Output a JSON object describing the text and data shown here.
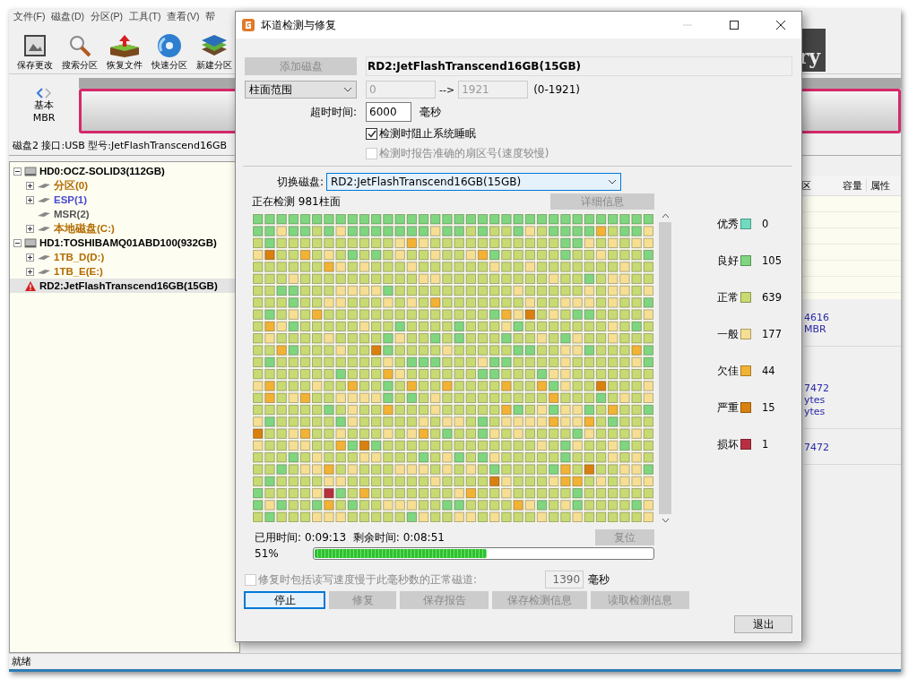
{
  "main_window": {
    "menu": [
      "文件(F)",
      "磁盘(D)",
      "分区(P)",
      "工具(T)",
      "查看(V)",
      "帮"
    ],
    "toolbar": [
      {
        "label": "保存更改",
        "kind": "save"
      },
      {
        "label": "搜索分区",
        "kind": "search"
      },
      {
        "label": "恢复文件",
        "kind": "recover"
      },
      {
        "label": "快速分区",
        "kind": "quick"
      },
      {
        "label": "新建分区",
        "kind": "new"
      }
    ],
    "logo_text": "ry",
    "disk_map": {
      "type_lines": [
        "基本",
        "MBR"
      ]
    },
    "disk_info": "磁盘2 接口:USB  型号:JetFlashTranscend16GB",
    "tree": [
      {
        "label": "HD0:OCZ-SOLID3(112GB)",
        "kind": "disk",
        "color": "#000000",
        "expanded": true,
        "selected": false,
        "children": [
          {
            "label": "分区(0)",
            "kind": "partition",
            "color": "#b36b00",
            "expanded": false,
            "selected": false
          },
          {
            "label": "ESP(1)",
            "kind": "partition",
            "color": "#4a4ad0",
            "expanded": false,
            "selected": false
          },
          {
            "label": "MSR(2)",
            "kind": "partition",
            "color": "#555555",
            "selected": false
          },
          {
            "label": "本地磁盘(C:)",
            "kind": "partition",
            "color": "#b36b00",
            "expanded": false,
            "selected": false
          }
        ]
      },
      {
        "label": "HD1:TOSHIBAMQ01ABD100(932GB)",
        "kind": "disk",
        "color": "#000000",
        "expanded": true,
        "selected": false,
        "children": [
          {
            "label": "1TB_D(D:)",
            "kind": "partition",
            "color": "#b36b00",
            "expanded": false,
            "selected": false
          },
          {
            "label": "1TB_E(E:)",
            "kind": "partition",
            "color": "#b36b00",
            "expanded": false,
            "selected": false
          }
        ]
      },
      {
        "label": "RD2:JetFlashTranscend16GB(15GB)",
        "kind": "bad_disk",
        "color": "#000000",
        "selected": true
      }
    ],
    "columns": [
      "区",
      "容量",
      "属性"
    ],
    "detail_groups": [
      {
        "lines": [
          "4616",
          "MBR"
        ]
      },
      {
        "lines": [
          "7472",
          "ytes",
          "ytes"
        ]
      },
      {
        "lines": [
          "7472"
        ]
      }
    ],
    "status": "就绪"
  },
  "dialog": {
    "title": "坏道检测与修复",
    "add_disk_button": {
      "label": "添加磁盘",
      "disabled": true
    },
    "disk_name": "RD2:JetFlashTranscend16GB(15GB)",
    "range": {
      "mode": "柱面范围",
      "from": "0",
      "arrow": "-->",
      "to": "1921",
      "span": "(0-1921)"
    },
    "timeout": {
      "label": "超时时间:",
      "value": "6000",
      "unit": "毫秒"
    },
    "options": [
      {
        "label": "检测时阻止系统睡眠",
        "checked": true,
        "disabled": false
      },
      {
        "label": "检测时报告准确的扇区号(速度较慢)",
        "checked": false,
        "disabled": true
      }
    ],
    "switch_disk": {
      "label": "切换磁盘:",
      "value": "RD2:JetFlashTranscend16GB(15GB)"
    },
    "scan_status": "正在检测 981柱面",
    "details_button": {
      "label": "详细信息",
      "disabled": true
    },
    "legend": [
      {
        "label": "优秀",
        "color": "#6fdcc0",
        "count": "0"
      },
      {
        "label": "良好",
        "color": "#7fd67f",
        "count": "105"
      },
      {
        "label": "正常",
        "color": "#c8da72",
        "count": "639"
      },
      {
        "label": "一般",
        "color": "#f6df92",
        "count": "177"
      },
      {
        "label": "欠佳",
        "color": "#f2b234",
        "count": "44"
      },
      {
        "label": "严重",
        "color": "#d9800f",
        "count": "15"
      },
      {
        "label": "损坏",
        "color": "#b83040",
        "count": "1"
      }
    ],
    "elapsed": {
      "label": "已用时间:",
      "value": "0:09:13"
    },
    "remaining": {
      "label": "剩余时间:",
      "value": "0:08:51"
    },
    "reset_button": {
      "label": "复位",
      "disabled": true
    },
    "progress": {
      "text": "51%",
      "level": 0.51
    },
    "slow_track": {
      "label": "修复时包括读写速度慢于此毫秒数的正常磁道:",
      "checked": false,
      "disabled": true,
      "value": "1390",
      "unit": "毫秒"
    },
    "actions": [
      {
        "label": "停止",
        "disabled": false,
        "focused": true
      },
      {
        "label": "修复",
        "disabled": true,
        "focused": false
      },
      {
        "label": "保存报告",
        "disabled": true,
        "focused": false
      },
      {
        "label": "保存检测信息",
        "disabled": true,
        "focused": false
      },
      {
        "label": "读取检测信息",
        "disabled": true,
        "focused": false
      }
    ],
    "exit_button": {
      "label": "退出",
      "disabled": false
    }
  }
}
